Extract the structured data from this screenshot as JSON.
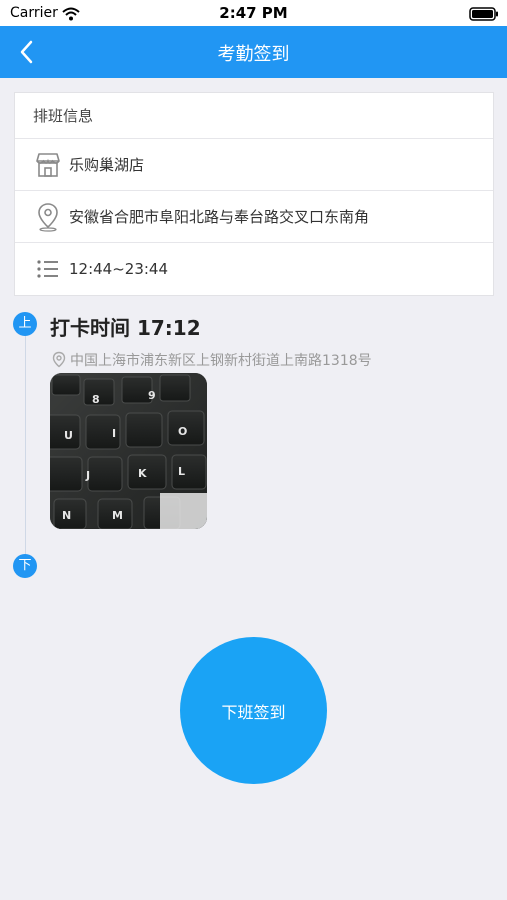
{
  "status_bar": {
    "carrier": "Carrier",
    "time": "2:47 PM"
  },
  "nav": {
    "title": "考勤签到"
  },
  "schedule": {
    "header": "排班信息",
    "store": "乐购巢湖店",
    "address": "安徽省合肥市阜阳北路与奉台路交叉口东南角",
    "hours": "12:44~23:44"
  },
  "timeline": {
    "start_badge": "上",
    "punch_time": "打卡时间 17:12",
    "punch_address": "中国上海市浦东新区上钢新村街道上南路1318号",
    "end_badge": "下"
  },
  "action": {
    "label": "下班签到"
  },
  "colors": {
    "accent": "#2196f3",
    "button": "#1aa3f5",
    "background": "#efeff4"
  }
}
